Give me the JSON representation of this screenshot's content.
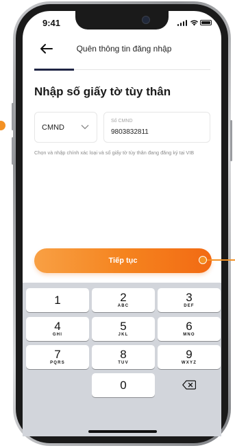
{
  "status_bar": {
    "time": "9:41"
  },
  "header": {
    "title": "Quên thông tin đăng nhập"
  },
  "progress": {
    "step_fraction": 0.22
  },
  "page": {
    "title": "Nhập số giấy tờ tùy thân"
  },
  "id_type": {
    "selected": "CMND"
  },
  "id_number": {
    "label": "Số CMND",
    "value": "9803832811"
  },
  "hint": "Chọn và nhập chính xác loại và số giấy tờ tùy thân đang đăng ký tại VIB",
  "continue_button": {
    "label": "Tiếp tục"
  },
  "keyboard": {
    "keys": [
      {
        "num": "1",
        "letters": ""
      },
      {
        "num": "2",
        "letters": "ABC"
      },
      {
        "num": "3",
        "letters": "DEF"
      },
      {
        "num": "4",
        "letters": "GHI"
      },
      {
        "num": "5",
        "letters": "JKL"
      },
      {
        "num": "6",
        "letters": "MNO"
      },
      {
        "num": "7",
        "letters": "PQRS"
      },
      {
        "num": "8",
        "letters": "TUV"
      },
      {
        "num": "9",
        "letters": "WXYZ"
      },
      {
        "num": "0",
        "letters": ""
      }
    ]
  },
  "colors": {
    "accent": "#f5841f",
    "progress": "#1f2544",
    "keyboard_bg": "#d2d5db"
  }
}
